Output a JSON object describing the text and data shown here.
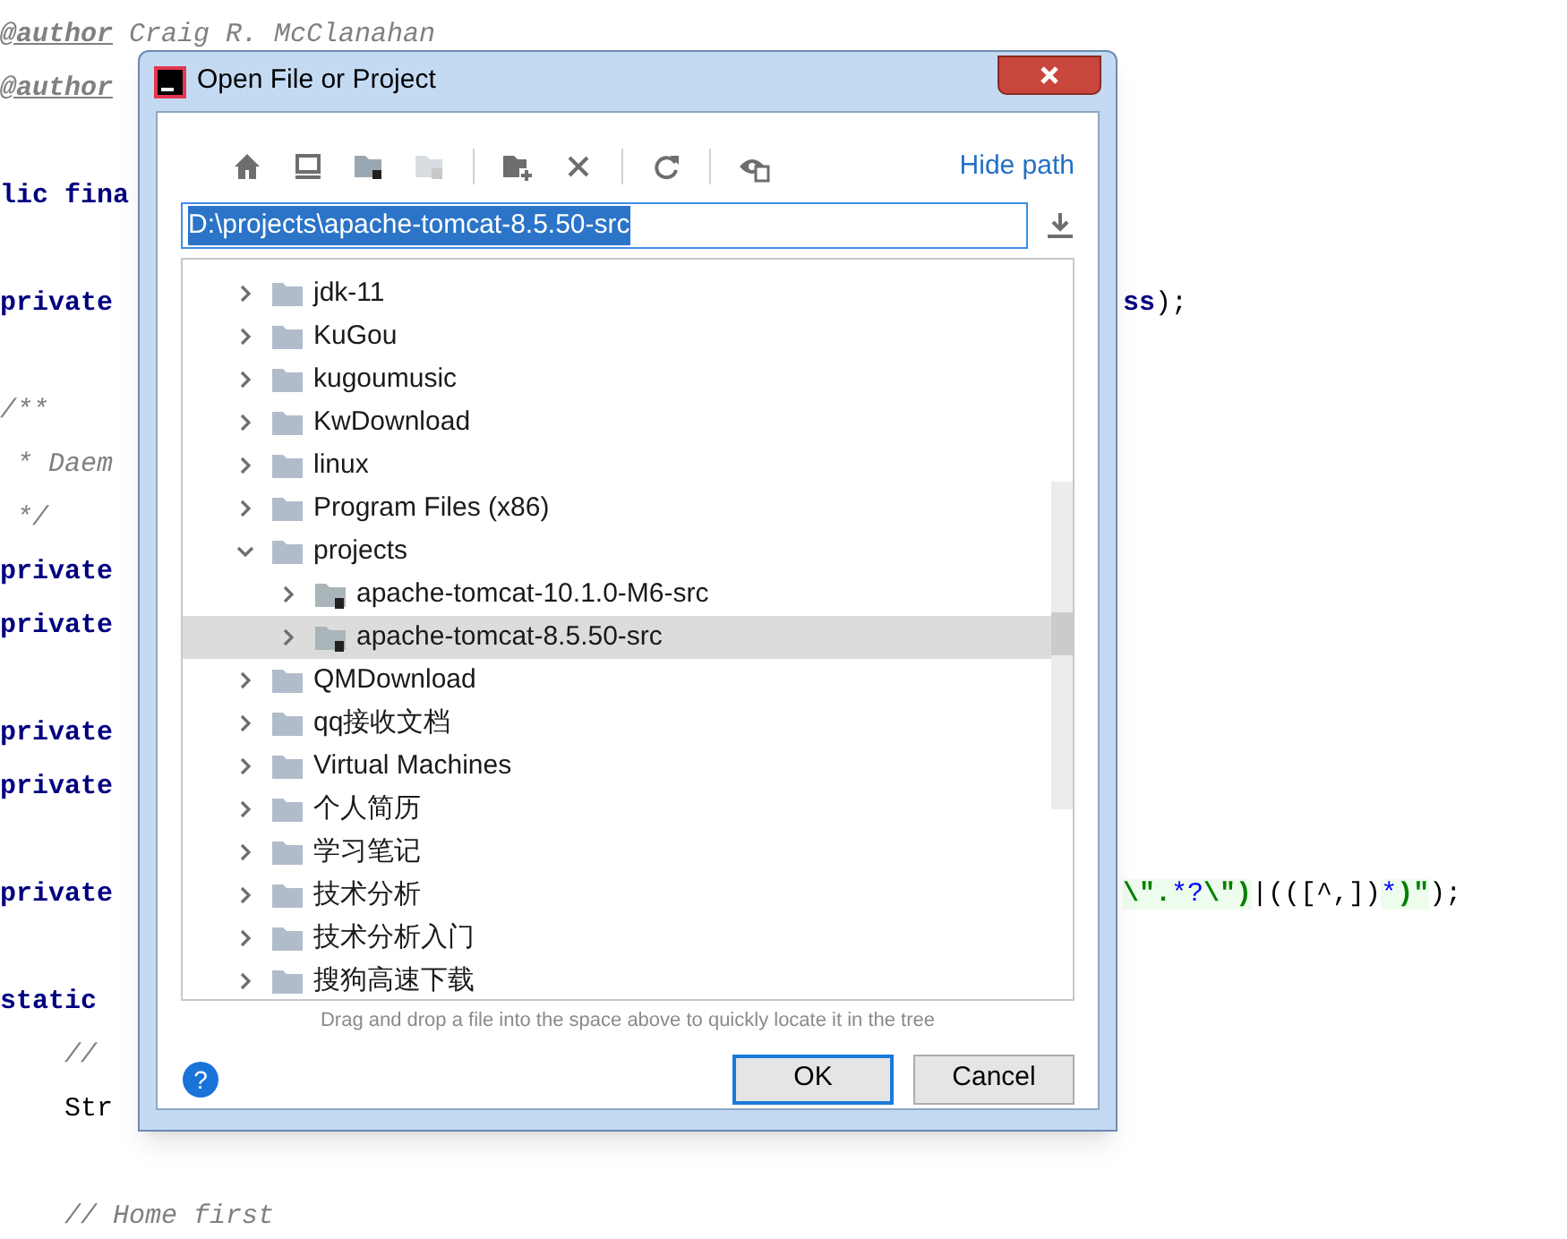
{
  "editor": {
    "blocks": [
      {
        "lines": [
          {
            "segments": [
              {
                "text": "@author",
                "kind": "doctag"
              },
              {
                "text": " Craig R. McClanahan",
                "kind": "comment"
              }
            ]
          },
          {
            "segments": [
              {
                "text": "@author",
                "kind": "doctag"
              }
            ]
          }
        ]
      },
      {
        "lines": [
          {
            "segments": [
              {
                "text": "lic fina",
                "kind": "keyword"
              }
            ]
          }
        ]
      },
      {
        "lines": [
          {
            "segments": [
              {
                "text": "private",
                "kind": "keyword"
              }
            ],
            "right": [
              {
                "text": "ss",
                "kind": "keyword"
              },
              {
                "text": ");",
                "kind": "plain"
              }
            ]
          }
        ]
      },
      {
        "lines": [
          {
            "segments": [
              {
                "text": "/**",
                "kind": "comment"
              }
            ]
          },
          {
            "segments": [
              {
                "text": " * Daem",
                "kind": "comment"
              }
            ]
          },
          {
            "segments": [
              {
                "text": " */",
                "kind": "comment"
              }
            ]
          },
          {
            "segments": [
              {
                "text": "private",
                "kind": "keyword"
              }
            ]
          },
          {
            "segments": [
              {
                "text": "private",
                "kind": "keyword"
              }
            ]
          }
        ]
      },
      {
        "lines": [
          {
            "segments": [
              {
                "text": "private",
                "kind": "keyword"
              }
            ]
          },
          {
            "segments": [
              {
                "text": "private",
                "kind": "keyword"
              }
            ]
          }
        ]
      },
      {
        "lines": [
          {
            "segments": [
              {
                "text": "private",
                "kind": "keyword"
              }
            ],
            "right": [
              {
                "text": "\\\".",
                "kind": "string"
              },
              {
                "text": "*?",
                "kind": "regex"
              },
              {
                "text": "\\\")",
                "kind": "string"
              },
              {
                "text": "|(([^,])",
                "kind": "plain"
              },
              {
                "text": "*",
                "kind": "regex"
              },
              {
                "text": ")\"",
                "kind": "string"
              },
              {
                "text": ");",
                "kind": "plain"
              }
            ]
          }
        ]
      },
      {
        "lines": [
          {
            "segments": [
              {
                "text": "static",
                "kind": "keyword"
              }
            ]
          },
          {
            "segments": [
              {
                "text": "    //",
                "kind": "comment"
              }
            ]
          },
          {
            "segments": [
              {
                "text": "    Str",
                "kind": "plain"
              }
            ]
          }
        ]
      },
      {
        "lines": [
          {
            "segments": [
              {
                "text": "    // Home first",
                "kind": "comment"
              }
            ]
          }
        ]
      }
    ]
  },
  "dialog": {
    "title": "Open File or Project",
    "toolbar": [
      {
        "kind": "home",
        "disabled": false
      },
      {
        "kind": "desktop",
        "disabled": false
      },
      {
        "kind": "module",
        "disabled": false
      },
      {
        "kind": "folder",
        "disabled": true
      },
      {
        "kind": "separator"
      },
      {
        "kind": "new-folder",
        "disabled": false
      },
      {
        "kind": "delete",
        "disabled": false
      },
      {
        "kind": "separator"
      },
      {
        "kind": "refresh",
        "disabled": false
      },
      {
        "kind": "separator"
      },
      {
        "kind": "hidden",
        "disabled": false
      }
    ],
    "hide_path": "Hide path",
    "path_field": {
      "value": "D:\\projects\\apache-tomcat-8.5.50-src",
      "text_selected": true
    },
    "tree": [
      {
        "label": "jdk-11",
        "expanded": false,
        "selected": false
      },
      {
        "label": "KuGou",
        "expanded": false,
        "selected": false
      },
      {
        "label": "kugoumusic",
        "expanded": false,
        "selected": false
      },
      {
        "label": "KwDownload",
        "expanded": false,
        "selected": false
      },
      {
        "label": "linux",
        "expanded": false,
        "selected": false
      },
      {
        "label": "Program Files (x86)",
        "expanded": false,
        "selected": false
      },
      {
        "label": "projects",
        "expanded": true,
        "selected": false,
        "children": [
          {
            "label": "apache-tomcat-10.1.0-M6-src",
            "expanded": false,
            "selected": false
          },
          {
            "label": "apache-tomcat-8.5.50-src",
            "expanded": false,
            "selected": true
          }
        ]
      },
      {
        "label": "QMDownload",
        "expanded": false,
        "selected": false
      },
      {
        "label": "qq接收文档",
        "expanded": false,
        "selected": false
      },
      {
        "label": "Virtual Machines",
        "expanded": false,
        "selected": false
      },
      {
        "label": "个人简历",
        "expanded": false,
        "selected": false
      },
      {
        "label": "学习笔记",
        "expanded": false,
        "selected": false
      },
      {
        "label": "技术分析",
        "expanded": false,
        "selected": false
      },
      {
        "label": "技术分析入门",
        "expanded": false,
        "selected": false
      },
      {
        "label": "搜狗高速下载",
        "expanded": false,
        "selected": false
      }
    ],
    "hint": "Drag and drop a file into the space above to quickly locate it in the tree",
    "help": "?",
    "buttons": [
      {
        "label": "OK",
        "default": true
      },
      {
        "label": "Cancel",
        "default": false
      }
    ]
  }
}
